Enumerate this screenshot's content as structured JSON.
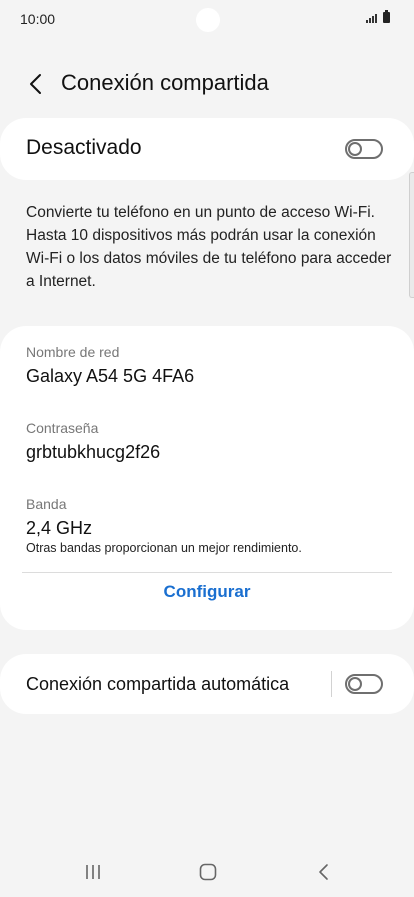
{
  "status_bar": {
    "time": "10:00"
  },
  "header": {
    "title": "Conexión compartida"
  },
  "master_switch": {
    "label": "Desactivado",
    "state": "off"
  },
  "description": "Convierte tu teléfono en un punto de acceso Wi-Fi. Hasta 10 dispositivos más podrán usar la conexión Wi-Fi o los datos móviles de tu teléfono para acceder a Internet.",
  "network": {
    "name_label": "Nombre de red",
    "name_value": "Galaxy A54 5G 4FA6",
    "password_label": "Contraseña",
    "password_value": "grbtubkhucg2f26",
    "band_label": "Banda",
    "band_value": "2,4 GHz",
    "band_note": "Otras bandas proporcionan un mejor rendimiento.",
    "configure_label": "Configurar"
  },
  "auto_hotspot": {
    "label": "Conexión compartida automática",
    "state": "off"
  },
  "colors": {
    "background": "#f4f4f4",
    "card": "#ffffff",
    "accent": "#1a6fd0",
    "toggle_off": "#6f6f6f"
  },
  "icons": {
    "back": "chevron-left-icon",
    "recents": "recent-apps-icon",
    "home": "home-icon",
    "nav_back": "nav-back-icon"
  }
}
